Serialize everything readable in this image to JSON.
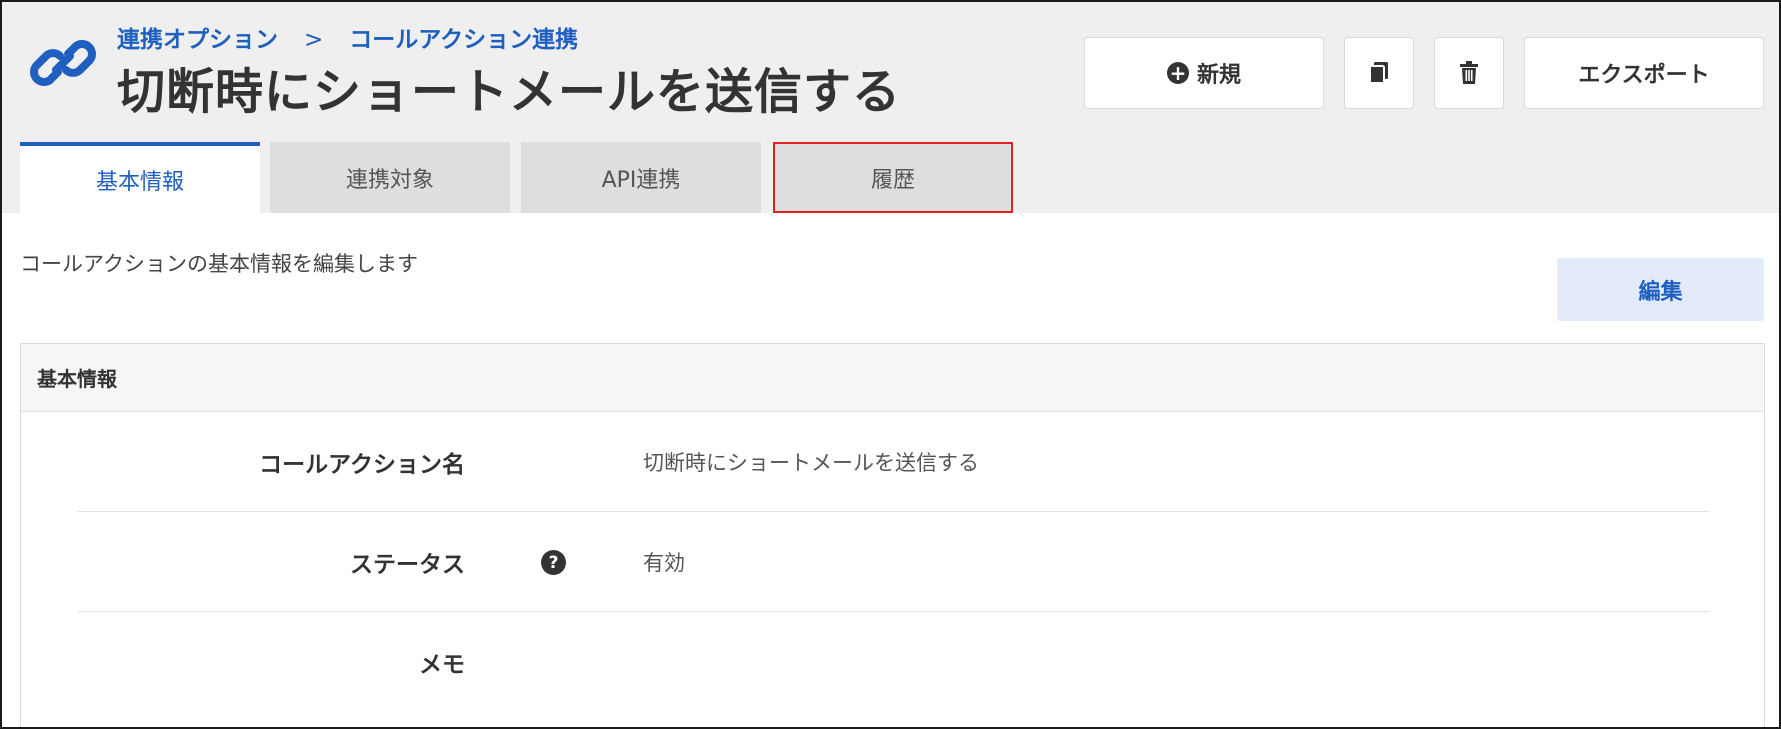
{
  "header": {
    "icon": "link-icon",
    "breadcrumb": {
      "parent": "連携オプション",
      "separator": ">",
      "current": "コールアクション連携"
    },
    "title": "切断時にショートメールを送信する"
  },
  "toolbar": {
    "new_label": "新規",
    "new_icon": "plus-circle-icon",
    "copy_icon": "copy-icon",
    "delete_icon": "trash-icon",
    "export_label": "エクスポート"
  },
  "tabs": [
    {
      "label": "基本情報",
      "active": true
    },
    {
      "label": "連携対象",
      "active": false
    },
    {
      "label": "API連携",
      "active": false
    },
    {
      "label": "履歴",
      "active": false,
      "highlighted": true
    }
  ],
  "main": {
    "description": "コールアクションの基本情報を編集します",
    "edit_label": "編集"
  },
  "panel": {
    "title": "基本情報",
    "rows": [
      {
        "label": "コールアクション名",
        "value": "切断時にショートメールを送信する"
      },
      {
        "label": "ステータス",
        "value": "有効",
        "help_icon": "question-circle-icon"
      },
      {
        "label": "メモ",
        "value": ""
      }
    ]
  },
  "colors": {
    "accent": "#1f5fbf",
    "highlight_border": "#e02020",
    "edit_bg": "#e3ebfb"
  }
}
